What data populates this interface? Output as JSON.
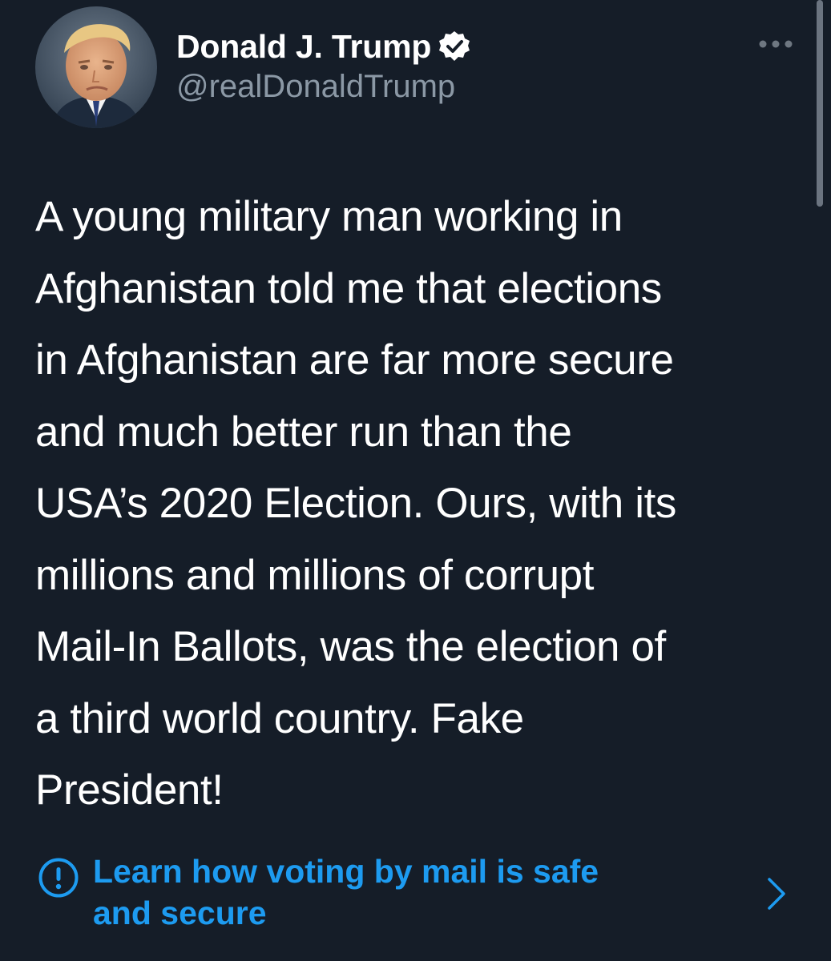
{
  "header": {
    "display_name": "Donald J. Trump",
    "handle": "@realDonaldTrump",
    "verified_icon": "verified-badge-icon",
    "more_icon": "more-options-icon"
  },
  "tweet": {
    "lines": [
      "A young military man working in",
      "Afghanistan told me that elections",
      "in Afghanistan are far more secure",
      "and much better run than the",
      "USA’s 2020 Election. Ours, with its",
      "millions and millions of corrupt",
      "Mail-In Ballots, was the election of",
      "a third world country. Fake",
      "President!"
    ]
  },
  "notice": {
    "icon": "exclamation-circle-icon",
    "lines": [
      "Learn how voting by mail is safe",
      "and secure"
    ],
    "chevron_icon": "chevron-right-icon"
  },
  "colors": {
    "background": "#151d28",
    "text": "#ffffff",
    "secondary": "#8b98a5",
    "accent": "#1d9bf0"
  }
}
